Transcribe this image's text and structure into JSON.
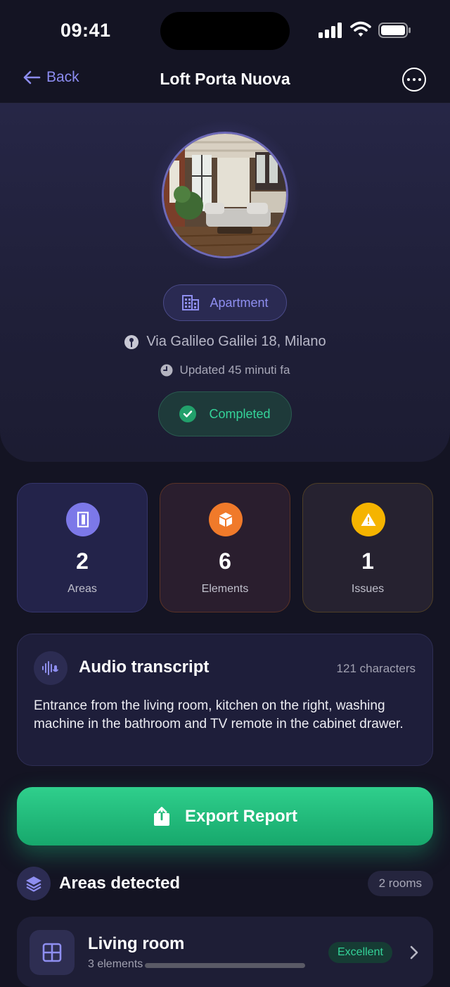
{
  "status_bar": {
    "time": "09:41"
  },
  "nav": {
    "back_label": "Back",
    "title": "Loft Porta Nuova"
  },
  "property": {
    "type_label": "Apartment",
    "address": "Via Galileo Galilei 18, Milano",
    "updated": "Updated 45 minuti fa",
    "status": "Completed"
  },
  "stats": [
    {
      "value": "2",
      "label": "Areas",
      "icon": "door-icon",
      "color": "#7c78e8"
    },
    {
      "value": "6",
      "label": "Elements",
      "icon": "box-icon",
      "color": "#f07a2a"
    },
    {
      "value": "1",
      "label": "Issues",
      "icon": "warning-icon",
      "color": "#f5b400"
    }
  ],
  "transcript": {
    "title": "Audio transcript",
    "count": "121 characters",
    "text": "Entrance from the living room, kitchen on the right, washing machine in the bathroom and TV remote in the cabinet drawer."
  },
  "export": {
    "label": "Export Report"
  },
  "areas": {
    "title": "Areas detected",
    "badge": "2 rooms",
    "items": [
      {
        "name": "Living room",
        "sub": "3 elements",
        "rating": "Excellent"
      }
    ]
  },
  "colors": {
    "accent": "#8c8cf0",
    "success": "#34d399",
    "export": "#22b878",
    "background": "#141423"
  }
}
